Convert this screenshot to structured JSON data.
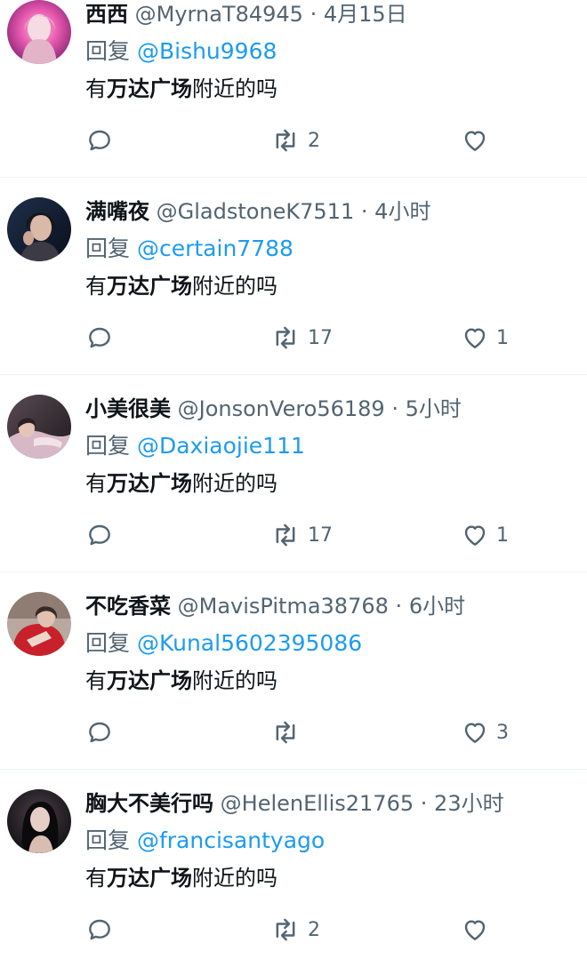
{
  "tweets": [
    {
      "name": "西西",
      "handle": "@MyrnaT84945",
      "separator": "·",
      "time": "4月15日",
      "reply_label": "回复",
      "reply_to": "@Bishu9968",
      "text_parts": [
        "有",
        "万达广场",
        "附近的吗"
      ],
      "retweets": "2",
      "likes": "",
      "avatar_icon": "avatar-pink-hair-photo"
    },
    {
      "name": "满嘴夜",
      "handle": "@GladstoneK7511",
      "separator": "·",
      "time": "4小时",
      "reply_label": "回复",
      "reply_to": "@certain7788",
      "text_parts": [
        "有",
        "万达广场",
        "附近的吗"
      ],
      "retweets": "17",
      "likes": "1",
      "avatar_icon": "avatar-dark-portrait-photo"
    },
    {
      "name": "小美很美",
      "handle": "@JonsonVero56189",
      "separator": "·",
      "time": "5小时",
      "reply_label": "回复",
      "reply_to": "@Daxiaojie111",
      "text_parts": [
        "有",
        "万达广场",
        "附近的吗"
      ],
      "retweets": "17",
      "likes": "1",
      "avatar_icon": "avatar-reclining-photo"
    },
    {
      "name": "不吃香菜",
      "handle": "@MavisPitma38768",
      "separator": "·",
      "time": "6小时",
      "reply_label": "回复",
      "reply_to": "@Kunal5602395086",
      "text_parts": [
        "有",
        "万达广场",
        "附近的吗"
      ],
      "retweets": "",
      "likes": "3",
      "avatar_icon": "avatar-red-outfit-photo"
    },
    {
      "name": "胸大不美行吗",
      "handle": "@HelenEllis21765",
      "separator": "·",
      "time": "23小时",
      "reply_label": "回复",
      "reply_to": "@francisantyago",
      "text_parts": [
        "有",
        "万达广场",
        "附近的吗"
      ],
      "retweets": "2",
      "likes": "",
      "avatar_icon": "avatar-black-hair-photo"
    }
  ],
  "colors": {
    "text": "#0f1419",
    "secondary": "#536471",
    "link": "#1d9bf0",
    "divider": "#eff3f4"
  },
  "icons": {
    "reply": "reply-icon",
    "retweet": "retweet-icon",
    "like": "heart-icon"
  }
}
